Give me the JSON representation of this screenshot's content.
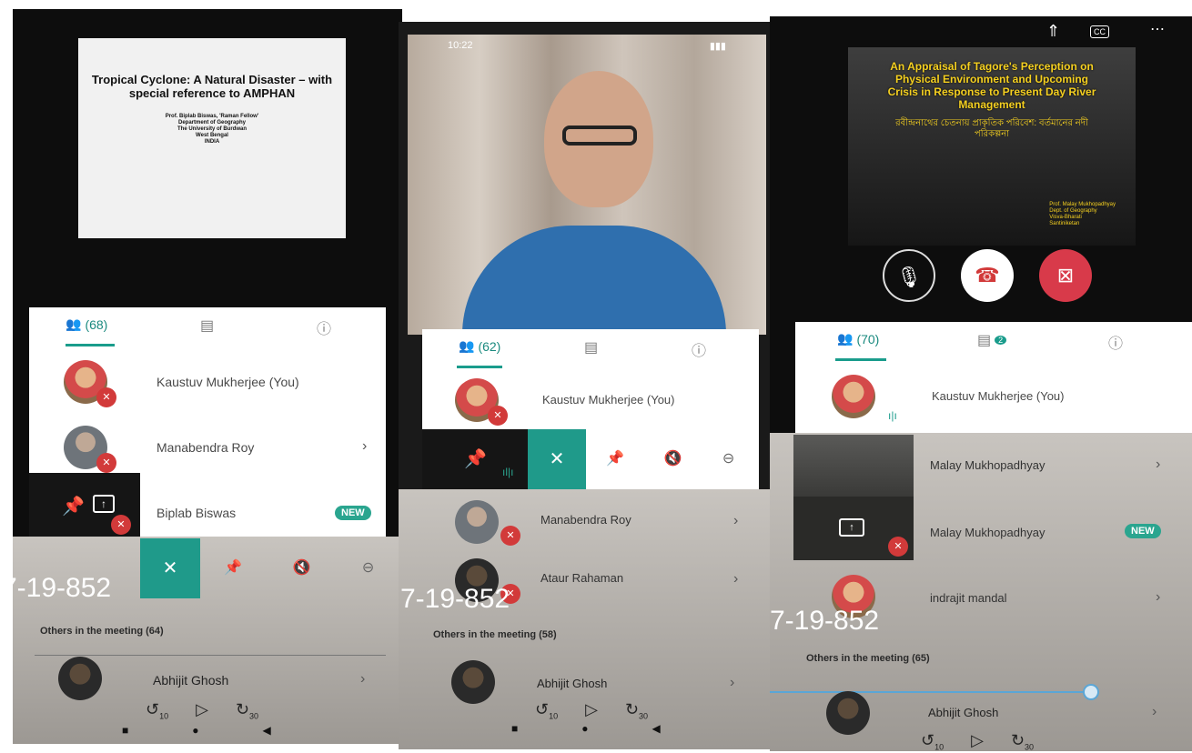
{
  "stamp_text": "7-19-852",
  "panel1": {
    "slide": {
      "title": "Tropical Cyclone: A Natural Disaster – with special reference to AMPHAN",
      "author": "Prof. Biplab Biswas, 'Raman Fellow'",
      "affiliation_lines": [
        "Department of Geography",
        "The University of Burdwan",
        "West Bengal",
        "INDIA"
      ]
    },
    "tabs": {
      "participants_count": "(68)"
    },
    "participants": [
      {
        "name": "Kaustuv Mukherjee (You)"
      },
      {
        "name": "Manabendra Roy"
      },
      {
        "name": "Biplab Biswas",
        "badge": "NEW"
      }
    ],
    "others_label": "Others in the meeting (64)",
    "others_first": {
      "name": "Abhijit Ghosh"
    },
    "media": {
      "rewind": "10",
      "forward": "30"
    }
  },
  "panel2": {
    "status_time": "10:22",
    "tabs": {
      "participants_count": "(62)"
    },
    "participants": [
      {
        "name": "Kaustuv Mukherjee (You)"
      },
      {
        "name": "Manabendra Roy"
      },
      {
        "name": "Ataur Rahaman"
      }
    ],
    "others_label": "Others in the meeting (58)",
    "others_first": {
      "name": "Abhijit Ghosh"
    },
    "media": {
      "rewind": "10",
      "forward": "30"
    }
  },
  "panel3": {
    "top_icons": [
      "cast-icon",
      "captions-icon",
      "more-icon"
    ],
    "captions_label": "CC",
    "slide": {
      "title": "An Appraisal of Tagore's Perception on Physical Environment and Upcoming Crisis in Response to Present Day River Management",
      "bengali": "রবীন্দ্রনাথের চেতনায় প্রাকৃতিক পরিবেশ: বর্তমানের নদী পরিকল্পনা",
      "author_lines": [
        "Prof. Malay Mukhopadhyay",
        "Dept. of Geography",
        "Visva-Bharati",
        "Santiniketan"
      ]
    },
    "tabs": {
      "participants_count": "(70)",
      "chat_badge": "2"
    },
    "participants": [
      {
        "name": "Kaustuv Mukherjee (You)"
      },
      {
        "name": "Malay Mukhopadhyay"
      },
      {
        "name": "Malay Mukhopadhyay",
        "badge": "NEW"
      },
      {
        "name": "indrajit mandal"
      }
    ],
    "others_label": "Others in the meeting (65)",
    "others_first": {
      "name": "Abhijit Ghosh"
    },
    "media": {
      "rewind": "10",
      "forward": "30"
    }
  },
  "colors": {
    "accent": "#1a9c8c",
    "muted": "#d23a3a",
    "slide_text": "#f5d020"
  }
}
